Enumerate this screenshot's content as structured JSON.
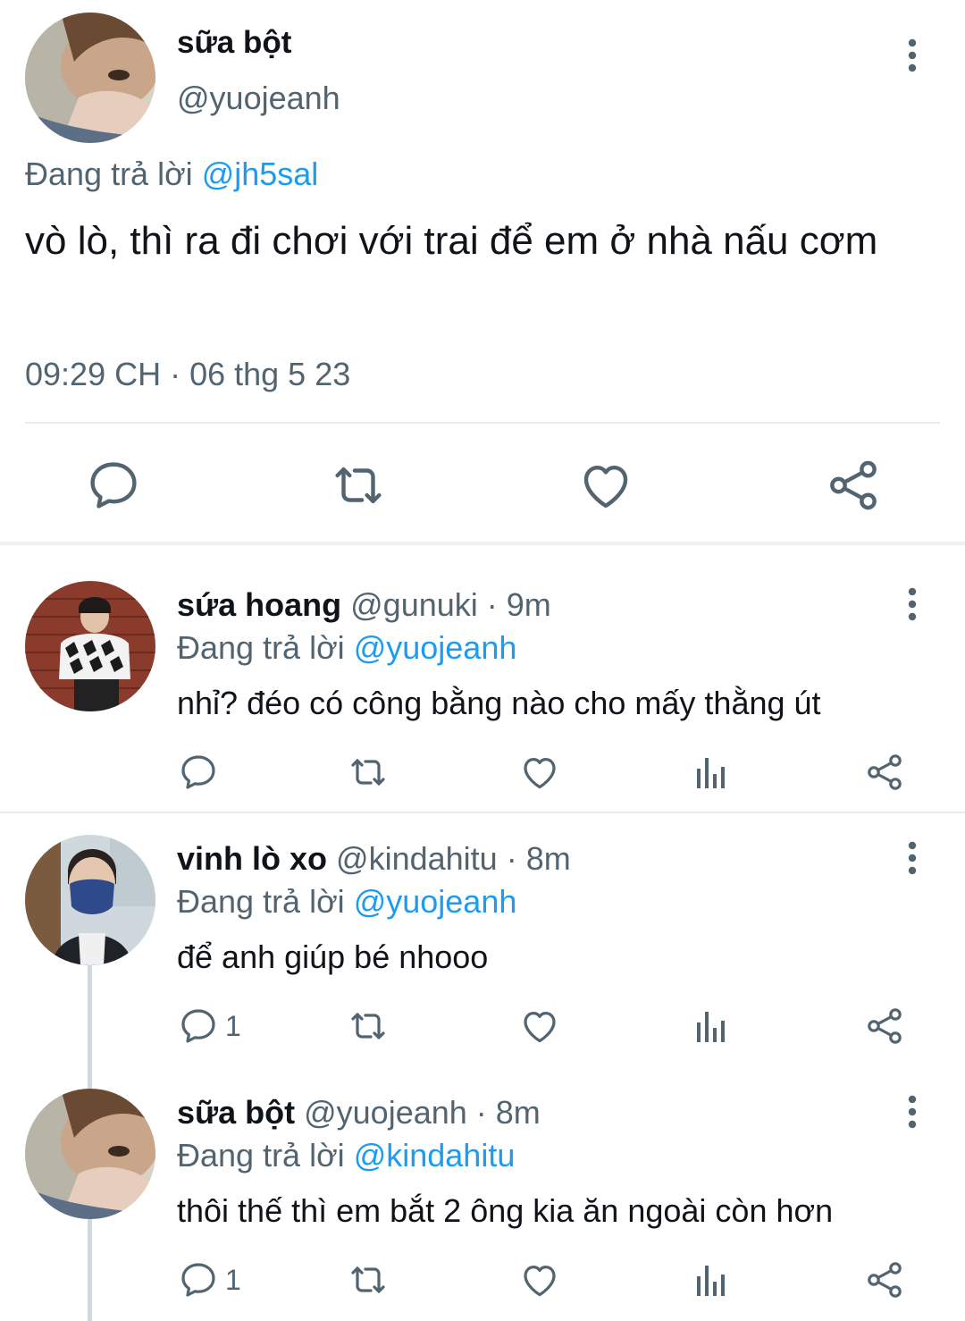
{
  "main_tweet": {
    "display_name": "sữa bột",
    "handle": "@yuojeanh",
    "replying_label": "Đang trả lời",
    "replying_to": "@jh5sal",
    "text": "vò lò, thì ra đi chơi với trai để em ở nhà nấu cơm",
    "timestamp": "09:29 CH · 06 thg 5 23",
    "actions": [
      "reply-icon",
      "retweet-icon",
      "like-icon",
      "share-icon"
    ]
  },
  "replies": [
    {
      "display_name": "sứa hoang",
      "handle": "@gunuki",
      "time": "· 9m",
      "replying_label": "Đang trả lời",
      "replying_to": "@yuojeanh",
      "text": "nhỉ? đéo có công bằng nào cho mấy thằng út",
      "reply_count": ""
    },
    {
      "display_name": "vinh lò xo",
      "handle": "@kindahitu",
      "time": "· 8m",
      "replying_label": "Đang trả lời",
      "replying_to": "@yuojeanh",
      "text": "để anh giúp bé nhooo",
      "reply_count": "1"
    },
    {
      "display_name": "sữa bột",
      "handle": "@yuojeanh",
      "time": "· 8m",
      "replying_label": "Đang trả lời",
      "replying_to": "@kindahitu",
      "text": "thôi thế thì em bắt 2 ông kia ăn ngoài còn hơn",
      "reply_count": "1"
    }
  ],
  "colors": {
    "text": "#0f1419",
    "secondary": "#536471",
    "link": "#1d9bf0",
    "divider": "#e6ecf0"
  }
}
